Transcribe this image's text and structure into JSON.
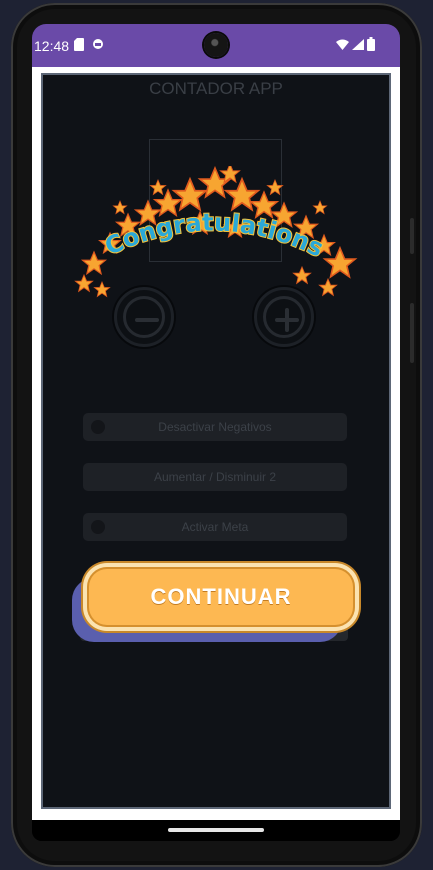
{
  "status_bar": {
    "time": "12:48",
    "left_icons": [
      "sd-card-icon",
      "sync-icon"
    ],
    "right_icons": [
      "wifi-icon",
      "signal-icon",
      "battery-icon"
    ]
  },
  "app": {
    "title": "CONTADOR APP",
    "decrement_icon": "minus-icon",
    "increment_icon": "plus-icon",
    "options": [
      {
        "label": "Desactivar Negativos",
        "type": "switch"
      },
      {
        "label": "Aumentar / Disminuir 2",
        "type": "button"
      },
      {
        "label": "Activar Meta",
        "type": "switch"
      }
    ]
  },
  "overlay": {
    "banner_text": "Congratulations",
    "continue_label": "CONTINUAR",
    "colors": {
      "banner_fill": "#2aa8d8",
      "banner_outline": "#f5c33b",
      "star": "#f7a531",
      "continue_button": "#fdb852"
    }
  },
  "colors": {
    "status_bar": "#6a4aa8",
    "app_background": "#0f1217"
  }
}
